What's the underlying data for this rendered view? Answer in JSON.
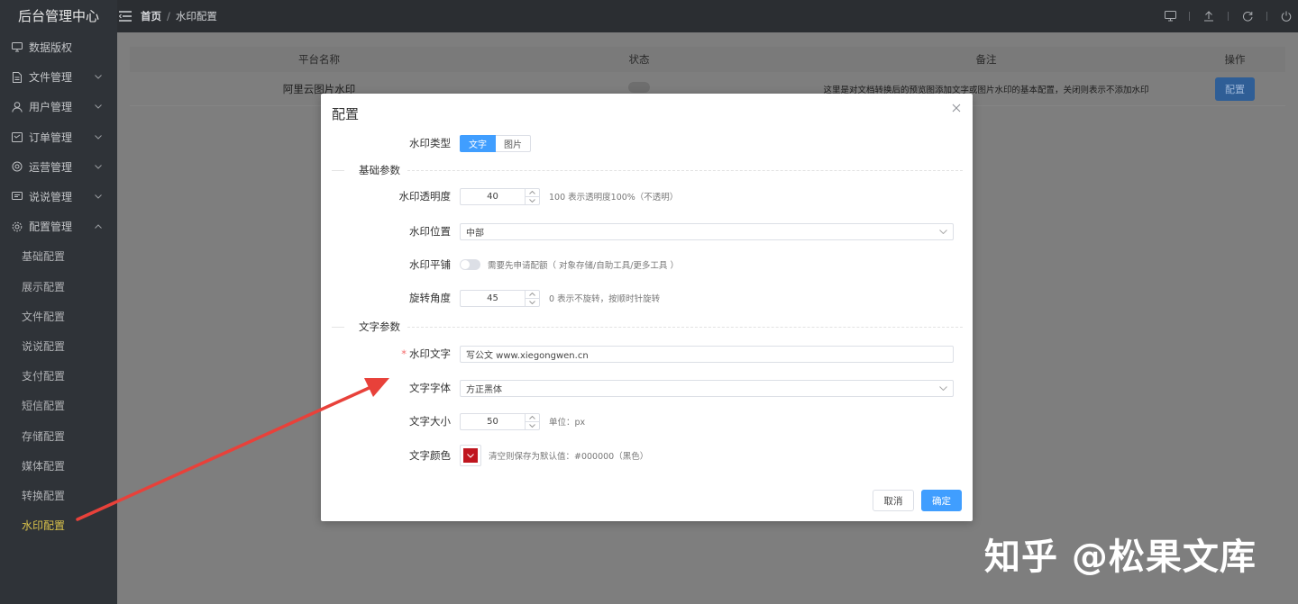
{
  "app": {
    "title": "后台管理中心"
  },
  "sidebar": {
    "items": [
      {
        "label": "数据版权",
        "icon": "monitor-icon"
      },
      {
        "label": "文件管理",
        "icon": "document-icon",
        "expand": "down"
      },
      {
        "label": "用户管理",
        "icon": "user-icon",
        "expand": "down"
      },
      {
        "label": "订单管理",
        "icon": "order-icon",
        "expand": "down"
      },
      {
        "label": "运营管理",
        "icon": "operations-icon",
        "expand": "down"
      },
      {
        "label": "说说管理",
        "icon": "chat-icon",
        "expand": "down"
      },
      {
        "label": "配置管理",
        "icon": "gear-icon",
        "expand": "up"
      }
    ],
    "sub_items": [
      {
        "label": "基础配置"
      },
      {
        "label": "展示配置"
      },
      {
        "label": "文件配置"
      },
      {
        "label": "说说配置"
      },
      {
        "label": "支付配置"
      },
      {
        "label": "短信配置"
      },
      {
        "label": "存储配置"
      },
      {
        "label": "媒体配置"
      },
      {
        "label": "转换配置"
      },
      {
        "label": "水印配置",
        "active": true
      }
    ]
  },
  "topbar": {
    "breadcrumb": {
      "home": "首页",
      "separator": "/",
      "current": "水印配置"
    },
    "icons": [
      "screen-icon",
      "upload-icon",
      "refresh-icon",
      "power-icon"
    ]
  },
  "table": {
    "headers": [
      "平台名称",
      "状态",
      "备注",
      "操作"
    ],
    "rows": [
      {
        "name": "阿里云图片水印",
        "note": "这里是对文档转换后的预览图添加文字或图片水印的基本配置，关闭则表示不添加水印",
        "action": "配置"
      }
    ]
  },
  "modal": {
    "title": "配置",
    "watermark_type": {
      "label": "水印类型",
      "options": [
        "文字",
        "图片"
      ],
      "selected": "文字"
    },
    "section_basic": "基础参数",
    "opacity": {
      "label": "水印透明度",
      "value": "40",
      "hint": "100 表示透明度100%（不透明）"
    },
    "position": {
      "label": "水印位置",
      "value": "中部"
    },
    "tile": {
      "label": "水印平铺",
      "hint": "需要先申请配额（ 对象存储/自助工具/更多工具 ）",
      "enabled": false
    },
    "rotation": {
      "label": "旋转角度",
      "value": "45",
      "hint": "0 表示不旋转，按顺时针旋转"
    },
    "section_text": "文字参数",
    "text": {
      "label": "水印文字",
      "required": "*",
      "value": "写公文 www.xiegongwen.cn"
    },
    "font": {
      "label": "文字字体",
      "value": "方正黑体"
    },
    "size": {
      "label": "文字大小",
      "value": "50",
      "hint": "单位：px"
    },
    "color": {
      "label": "文字颜色",
      "value": "#c0161f",
      "hint": "清空则保存为默认值：#000000（黑色）"
    },
    "cancel_label": "取消",
    "ok_label": "确定"
  },
  "annotation": {
    "arrow_color": "#e8413a"
  },
  "watermark_text": "知乎 @松果文库"
}
